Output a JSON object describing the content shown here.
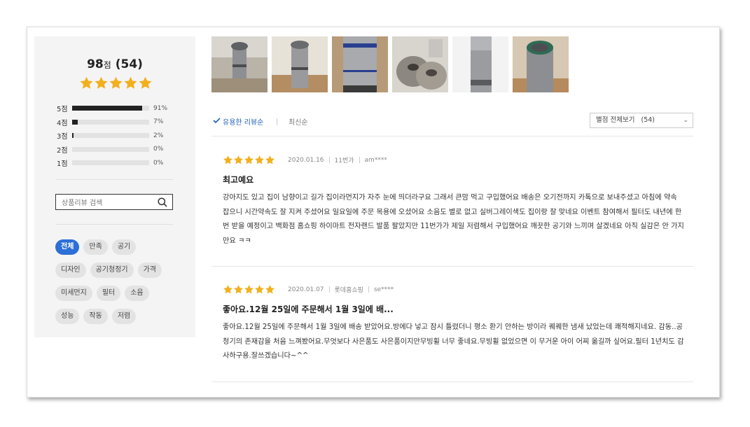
{
  "summary": {
    "score": "98",
    "score_unit": "점",
    "count": "(54)",
    "stars": 5,
    "distribution": [
      {
        "label": "5점",
        "percent": 91,
        "percent_text": "91%"
      },
      {
        "label": "4점",
        "percent": 7,
        "percent_text": "7%"
      },
      {
        "label": "3점",
        "percent": 2,
        "percent_text": "2%"
      },
      {
        "label": "2점",
        "percent": 0,
        "percent_text": "0%"
      },
      {
        "label": "1점",
        "percent": 0,
        "percent_text": "0%"
      }
    ]
  },
  "search": {
    "placeholder": "상품리뷰 검색"
  },
  "tags": [
    [
      {
        "label": "전체",
        "active": true
      },
      {
        "label": "만족"
      },
      {
        "label": "공기"
      }
    ],
    [
      {
        "label": "디자인"
      },
      {
        "label": "공기청정기"
      },
      {
        "label": "가격"
      }
    ],
    [
      {
        "label": "미세먼지"
      },
      {
        "label": "필터"
      },
      {
        "label": "소음"
      }
    ],
    [
      {
        "label": "성능"
      },
      {
        "label": "작동"
      },
      {
        "label": "저렴"
      }
    ]
  ],
  "sort": {
    "useful": "유용한 리뷰순",
    "recent": "최신순"
  },
  "filter": {
    "label": "별점 전체보기",
    "count": "(54)"
  },
  "reviews": [
    {
      "stars": 5,
      "date": "2020.01.16",
      "store": "11번가",
      "user": "am****",
      "title": "최고예요",
      "body": "강아지도 있고 집이 남향이고 길가 집이라먼지가 자주 눈에 띄더라구요 그래서 큰맘 먹고 구입했어요 배송은 오기전까지 카톡으로 보내주셨고 아침에 약속 잡으니 시간약속도 잘 지켜 주셨어요 일요일에 주문 목용에 오셨어요 소음도 별로 없고 실버그레이색도 집이랑 잘 맞네요 이벤트 참여해서 필터도 내년에 한번 받을 예정이고 백화점 홈쇼핑 하이마트 전자랜드 발품 팔았지만 11번가가 제일 저렴해서 구입했어요 깨끗한 공기와 느끼며 살겠네요 아직 실감은 안 가지만요 ㅋㅋ"
    },
    {
      "stars": 5,
      "date": "2020.01.07",
      "store": "롯데홈쇼핑",
      "user": "se****",
      "title": "좋아요.12월 25일에 주문해서 1월 3일에 배...",
      "body": "좋아요.12월 25일에 주문해서 1월 3일에 배송 받았어요.방에다 넣고 잠시 틀렸더니 평소 환기 안하는 방이라 퀘퀘한 냄새 났었는데 쾌적해지네요. 감동..공청기의 존재감을 처음 느껴봤어요.무엇보다 사은품도 사은품이지만무빙휠 너무 좋네요.무빙휠 없었으면 이 무거운 아이 어찌 옮길까 싶어요.필터 1년치도 감사하구용.잘쓰겠습니다~^^"
    }
  ],
  "colors": {
    "accent": "#2c6fd6",
    "star": "#f2b01e",
    "sort_active": "#1f5fb8"
  },
  "icons": {
    "search": "search-icon",
    "star": "star-icon",
    "check": "check-icon",
    "chevron": "chevron-down-icon"
  }
}
